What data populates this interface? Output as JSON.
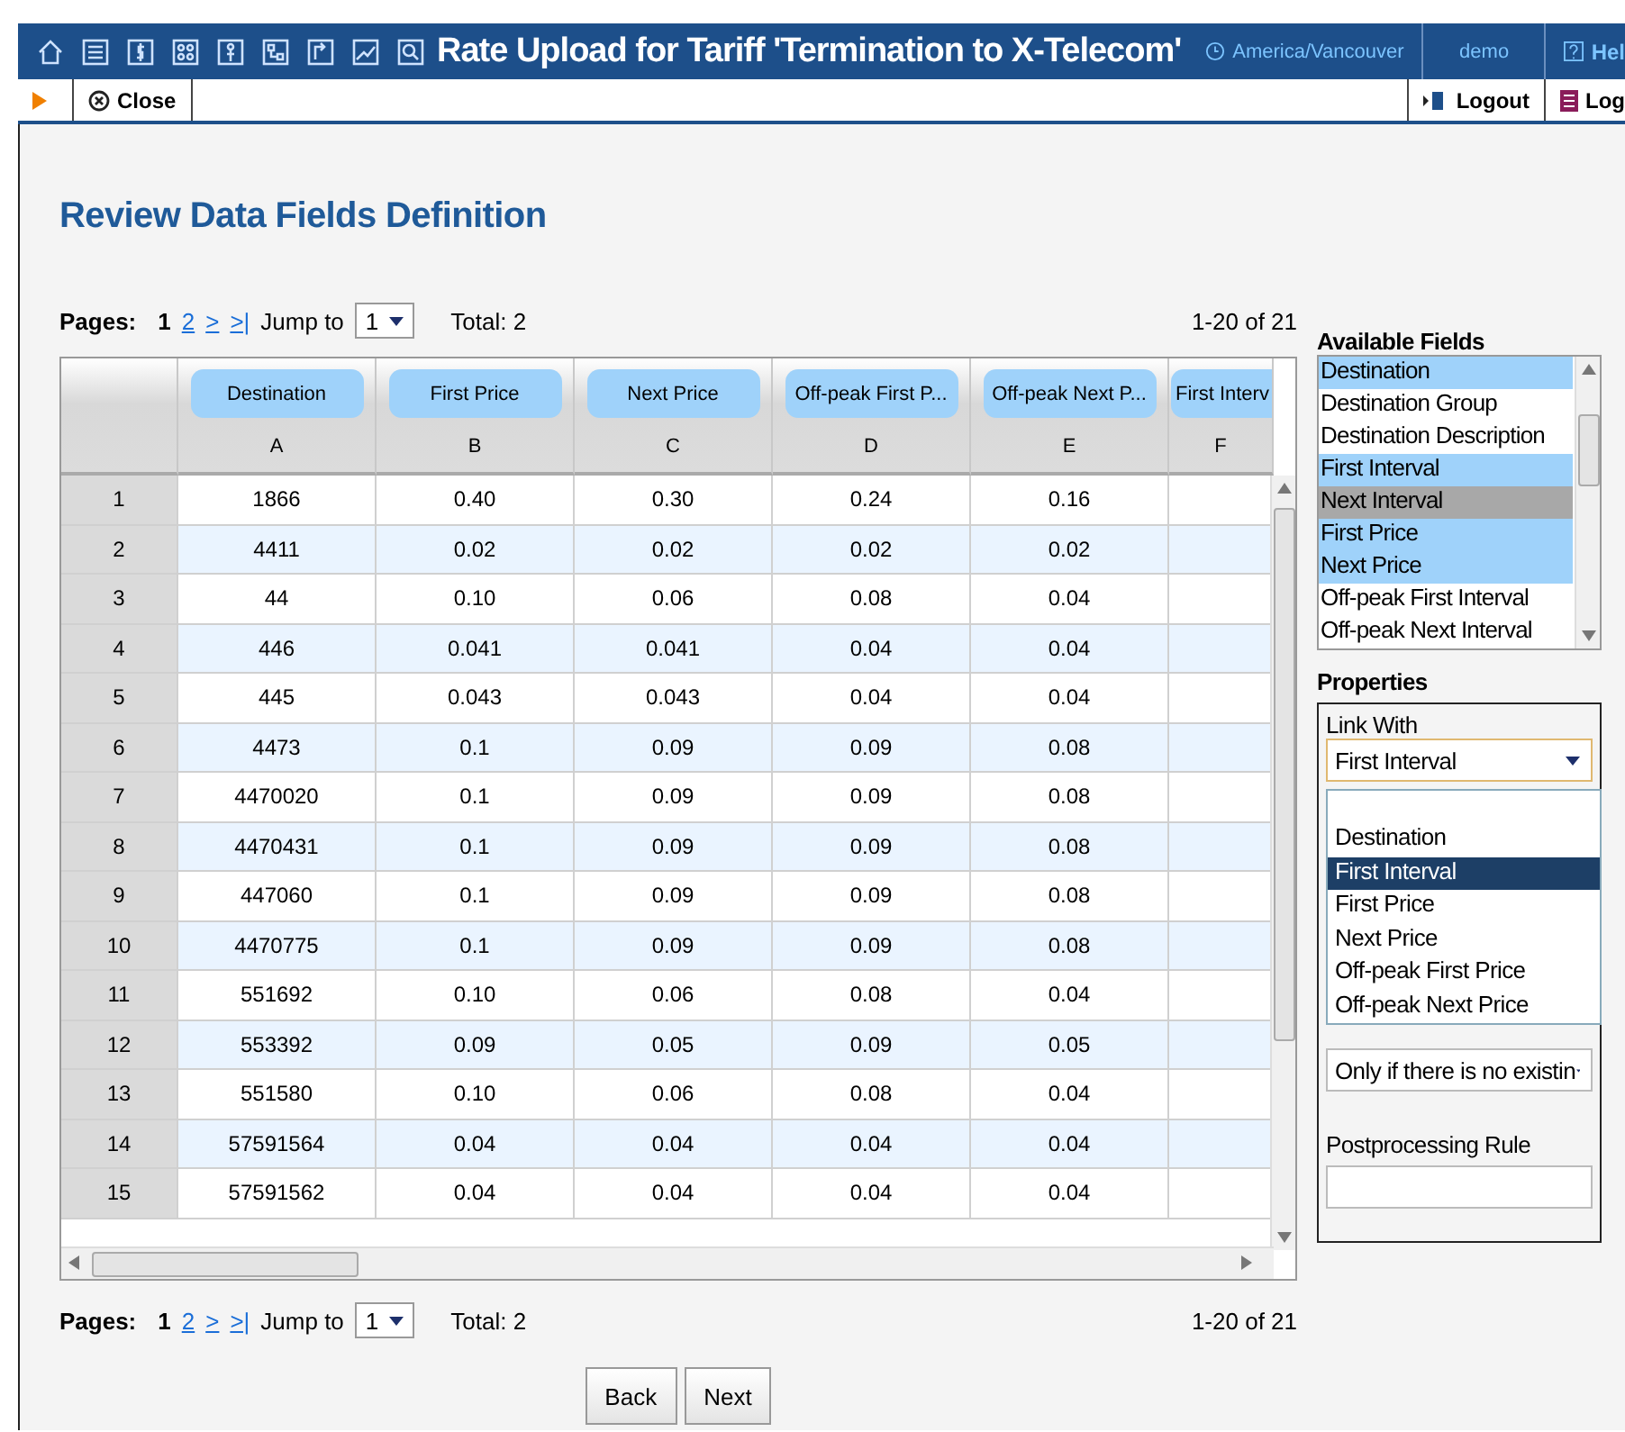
{
  "header": {
    "title": "Rate Upload for Tariff 'Termination to X-Telecom'",
    "timezone": "America/Vancouver",
    "user": "demo",
    "help": "Hel"
  },
  "toolbar": {
    "close": "Close",
    "logout": "Logout",
    "log": "Log"
  },
  "page_title": "Review Data Fields Definition",
  "pagination": [
    {
      "label": "Pages:",
      "pages": [
        {
          "text": "1",
          "selected": true
        },
        {
          "text": "2",
          "selected": false
        },
        {
          "text": ">",
          "selected": false
        },
        {
          "text": ">|",
          "selected": false
        }
      ],
      "jump_label": "Jump to",
      "jump_value": "1",
      "total": "Total: 2",
      "range": "1-20 of 21"
    },
    {
      "label": "Pages:",
      "pages": [
        {
          "text": "1",
          "selected": true
        },
        {
          "text": "2",
          "selected": false
        },
        {
          "text": ">",
          "selected": false
        },
        {
          "text": ">|",
          "selected": false
        }
      ],
      "jump_label": "Jump to",
      "jump_value": "1",
      "total": "Total: 2",
      "range": "1-20 of 21"
    }
  ],
  "table": {
    "columns": [
      {
        "field": "Destination",
        "letter": "A"
      },
      {
        "field": "First Price",
        "letter": "B"
      },
      {
        "field": "Next Price",
        "letter": "C"
      },
      {
        "field": "Off-peak First P...",
        "letter": "D"
      },
      {
        "field": "Off-peak Next P...",
        "letter": "E"
      },
      {
        "field": "First Interv",
        "letter": "F"
      }
    ],
    "rows": [
      {
        "num": "1",
        "cells": [
          "1866",
          "0.40",
          "0.30",
          "0.24",
          "0.16"
        ]
      },
      {
        "num": "2",
        "cells": [
          "4411",
          "0.02",
          "0.02",
          "0.02",
          "0.02"
        ]
      },
      {
        "num": "3",
        "cells": [
          "44",
          "0.10",
          "0.06",
          "0.08",
          "0.04"
        ]
      },
      {
        "num": "4",
        "cells": [
          "446",
          "0.041",
          "0.041",
          "0.04",
          "0.04"
        ]
      },
      {
        "num": "5",
        "cells": [
          "445",
          "0.043",
          "0.043",
          "0.04",
          "0.04"
        ]
      },
      {
        "num": "6",
        "cells": [
          "4473",
          "0.1",
          "0.09",
          "0.09",
          "0.08"
        ]
      },
      {
        "num": "7",
        "cells": [
          "4470020",
          "0.1",
          "0.09",
          "0.09",
          "0.08"
        ]
      },
      {
        "num": "8",
        "cells": [
          "4470431",
          "0.1",
          "0.09",
          "0.09",
          "0.08"
        ]
      },
      {
        "num": "9",
        "cells": [
          "447060",
          "0.1",
          "0.09",
          "0.09",
          "0.08"
        ]
      },
      {
        "num": "10",
        "cells": [
          "4470775",
          "0.1",
          "0.09",
          "0.09",
          "0.08"
        ]
      },
      {
        "num": "11",
        "cells": [
          "551692",
          "0.10",
          "0.06",
          "0.08",
          "0.04"
        ]
      },
      {
        "num": "12",
        "cells": [
          "553392",
          "0.09",
          "0.05",
          "0.09",
          "0.05"
        ]
      },
      {
        "num": "13",
        "cells": [
          "551580",
          "0.10",
          "0.06",
          "0.08",
          "0.04"
        ]
      },
      {
        "num": "14",
        "cells": [
          "57591564",
          "0.04",
          "0.04",
          "0.04",
          "0.04"
        ]
      },
      {
        "num": "15",
        "cells": [
          "57591562",
          "0.04",
          "0.04",
          "0.04",
          "0.04"
        ]
      }
    ]
  },
  "available_fields": {
    "title": "Available Fields",
    "items": [
      {
        "label": "Destination",
        "linked": true,
        "selected": false
      },
      {
        "label": "Destination Group",
        "linked": false,
        "selected": false
      },
      {
        "label": "Destination Description",
        "linked": false,
        "selected": false
      },
      {
        "label": "First Interval",
        "linked": true,
        "selected": false
      },
      {
        "label": "Next Interval",
        "linked": false,
        "selected": true
      },
      {
        "label": "First Price",
        "linked": true,
        "selected": false
      },
      {
        "label": "Next Price",
        "linked": true,
        "selected": false
      },
      {
        "label": "Off-peak First Interval",
        "linked": false,
        "selected": false
      },
      {
        "label": "Off-peak Next Interval",
        "linked": false,
        "selected": false
      }
    ]
  },
  "properties": {
    "title": "Properties",
    "link_label": "Link With",
    "link_value": "First Interval",
    "link_options": [
      {
        "label": "Destination",
        "selected": false
      },
      {
        "label": "First Interval",
        "selected": true
      },
      {
        "label": "First Price",
        "selected": false
      },
      {
        "label": "Next Price",
        "selected": false
      },
      {
        "label": "Off-peak First Price",
        "selected": false
      },
      {
        "label": "Off-peak Next Price",
        "selected": false
      }
    ],
    "default_value": "Only if there is no existin",
    "postprocessing_label": "Postprocessing Rule"
  },
  "buttons": [
    "Back",
    "Next"
  ]
}
